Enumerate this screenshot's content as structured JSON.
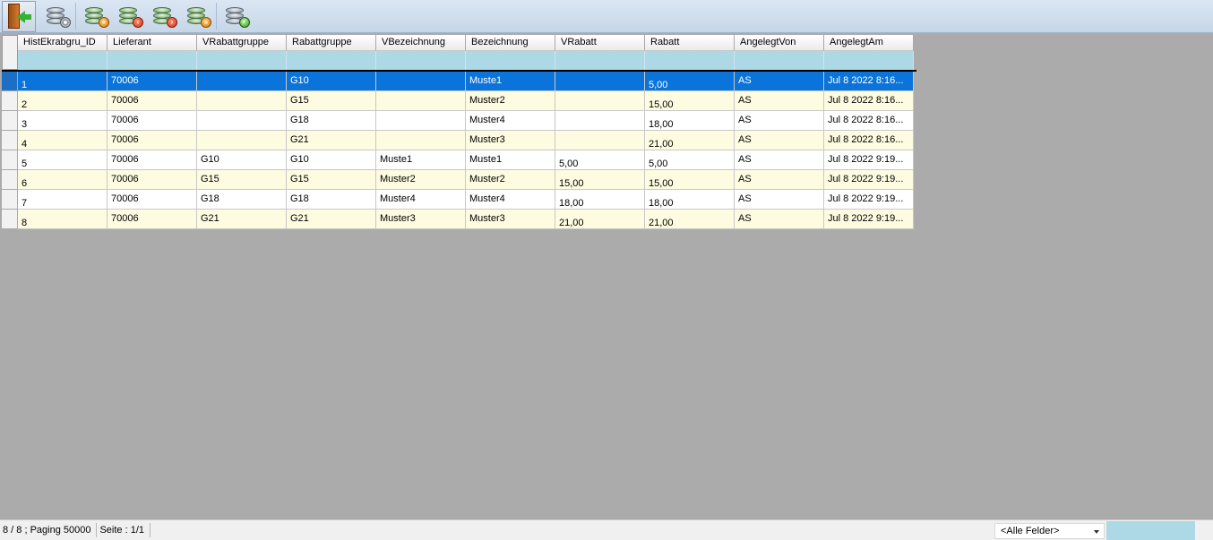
{
  "toolbar": {
    "buttons": [
      {
        "name": "exit-button",
        "icon": "exit-door-icon"
      },
      {
        "name": "settings-button",
        "icon": "database-gear-icon"
      },
      {
        "name": "first-button",
        "icon": "database-first-icon"
      },
      {
        "name": "previous-button",
        "icon": "database-previous-icon"
      },
      {
        "name": "next-button",
        "icon": "database-next-icon"
      },
      {
        "name": "last-button",
        "icon": "database-last-icon"
      },
      {
        "name": "save-button",
        "icon": "database-check-icon"
      }
    ]
  },
  "grid": {
    "columns": [
      "HistEkrabgru_ID",
      "Lieferant",
      "VRabattgruppe",
      "Rabattgruppe",
      "VBezeichnung",
      "Bezeichnung",
      "VRabatt",
      "Rabatt",
      "AngelegtVon",
      "AngelegtAm"
    ],
    "rows": [
      [
        "1",
        "70006",
        "",
        "G10",
        "",
        "Muste1",
        "",
        "5,00",
        "AS",
        "Jul  8 2022  8:16..."
      ],
      [
        "2",
        "70006",
        "",
        "G15",
        "",
        "Muster2",
        "",
        "15,00",
        "AS",
        "Jul  8 2022  8:16..."
      ],
      [
        "3",
        "70006",
        "",
        "G18",
        "",
        "Muster4",
        "",
        "18,00",
        "AS",
        "Jul  8 2022  8:16..."
      ],
      [
        "4",
        "70006",
        "",
        "G21",
        "",
        "Muster3",
        "",
        "21,00",
        "AS",
        "Jul  8 2022  8:16..."
      ],
      [
        "5",
        "70006",
        "G10",
        "G10",
        "Muste1",
        "Muste1",
        "5,00",
        "5,00",
        "AS",
        "Jul  8 2022  9:19..."
      ],
      [
        "6",
        "70006",
        "G15",
        "G15",
        "Muster2",
        "Muster2",
        "15,00",
        "15,00",
        "AS",
        "Jul  8 2022  9:19..."
      ],
      [
        "7",
        "70006",
        "G18",
        "G18",
        "Muster4",
        "Muster4",
        "18,00",
        "18,00",
        "AS",
        "Jul  8 2022  9:19..."
      ],
      [
        "8",
        "70006",
        "G21",
        "G21",
        "Muster3",
        "Muster3",
        "21,00",
        "21,00",
        "AS",
        "Jul  8 2022  9:19..."
      ]
    ],
    "selected_row": 0
  },
  "status": {
    "record_info": "8 / 8 ; Paging 50000",
    "page_info": "Seite : 1/1",
    "field_select": "<Alle Felder>"
  },
  "colors": {
    "selection": "#0a74da",
    "alt_row": "#fdfbe0",
    "filter_row": "#add8e6",
    "workspace": "#ababab"
  }
}
